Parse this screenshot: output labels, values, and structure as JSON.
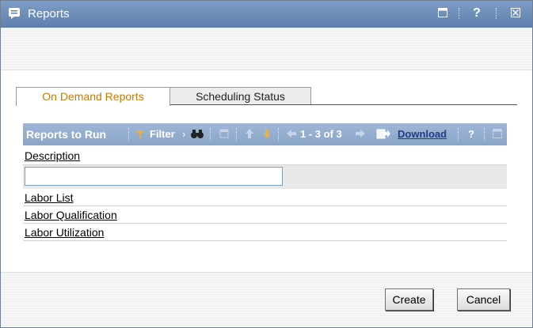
{
  "window": {
    "title": "Reports",
    "controls": {
      "help_label": "?",
      "close_label": "☒",
      "restore_label": "▭"
    }
  },
  "tabs": [
    {
      "label": "On Demand Reports",
      "active": true
    },
    {
      "label": "Scheduling Status",
      "active": false
    }
  ],
  "grid": {
    "toolbar": {
      "title": "Reports to Run",
      "filter_label": "Filter",
      "pagination": "1 - 3 of 3",
      "download_label": "Download",
      "help_label": "?"
    },
    "column_header": "Description",
    "filter_value": "",
    "rows": [
      {
        "label": "Labor List"
      },
      {
        "label": "Labor Qualification"
      },
      {
        "label": "Labor Utilization"
      }
    ]
  },
  "buttons": {
    "create_label": "Create",
    "cancel_label": "Cancel"
  },
  "colors": {
    "titlebar": "#6b8bb7",
    "grid_toolbar": "#93aecf",
    "active_tab_text": "#c97a00",
    "link": "#233b88"
  }
}
